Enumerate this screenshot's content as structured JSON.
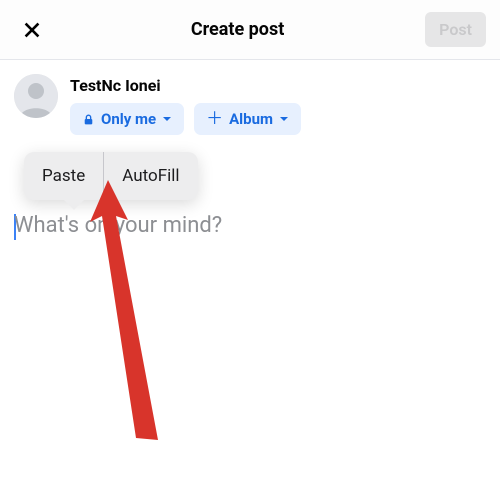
{
  "header": {
    "title": "Create post",
    "post_label": "Post"
  },
  "user": {
    "name": "TestNc Ionei"
  },
  "audience_pill": {
    "label": "Only me"
  },
  "album_pill": {
    "label": "Album"
  },
  "content": {
    "placeholder": "What's on your mind?"
  },
  "context_menu": {
    "paste": "Paste",
    "autofill": "AutoFill"
  },
  "colors": {
    "accent": "#1a6be0",
    "arrow": "#d8342b"
  }
}
